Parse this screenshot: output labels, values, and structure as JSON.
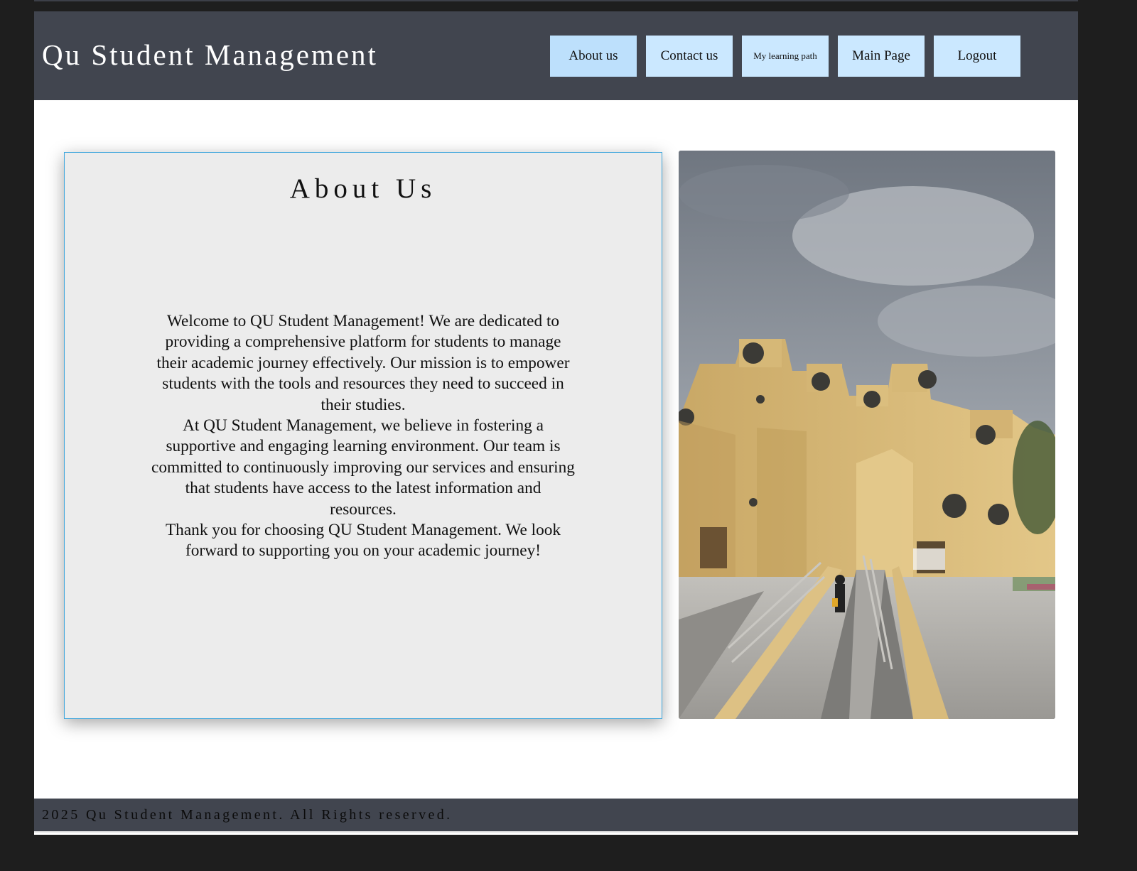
{
  "header": {
    "site_title": "Qu Student Management",
    "nav": [
      {
        "label": "About us"
      },
      {
        "label": "Contact us"
      },
      {
        "label": "My learning path"
      },
      {
        "label": "Main Page"
      },
      {
        "label": "Logout"
      }
    ]
  },
  "about": {
    "title": "About Us",
    "paragraphs": [
      "Welcome to QU Student Management! We are dedicated to providing a comprehensive platform for students to manage their academic journey effectively. Our mission is to empower students with the tools and resources they need to succeed in their studies.",
      "At QU Student Management, we believe in fostering a supportive and engaging learning environment. Our team is committed to continuously improving our services and ensuring that students have access to the latest information and resources.",
      "Thank you for choosing QU Student Management. We look forward to supporting you on your academic journey!"
    ]
  },
  "footer": {
    "text": "2025 Qu Student Management. All Rights reserved."
  },
  "colors": {
    "header_bg": "#41454f",
    "nav_button_bg": "#cbe8ff",
    "card_bg": "#ececec",
    "card_border": "#3fa6dd"
  }
}
